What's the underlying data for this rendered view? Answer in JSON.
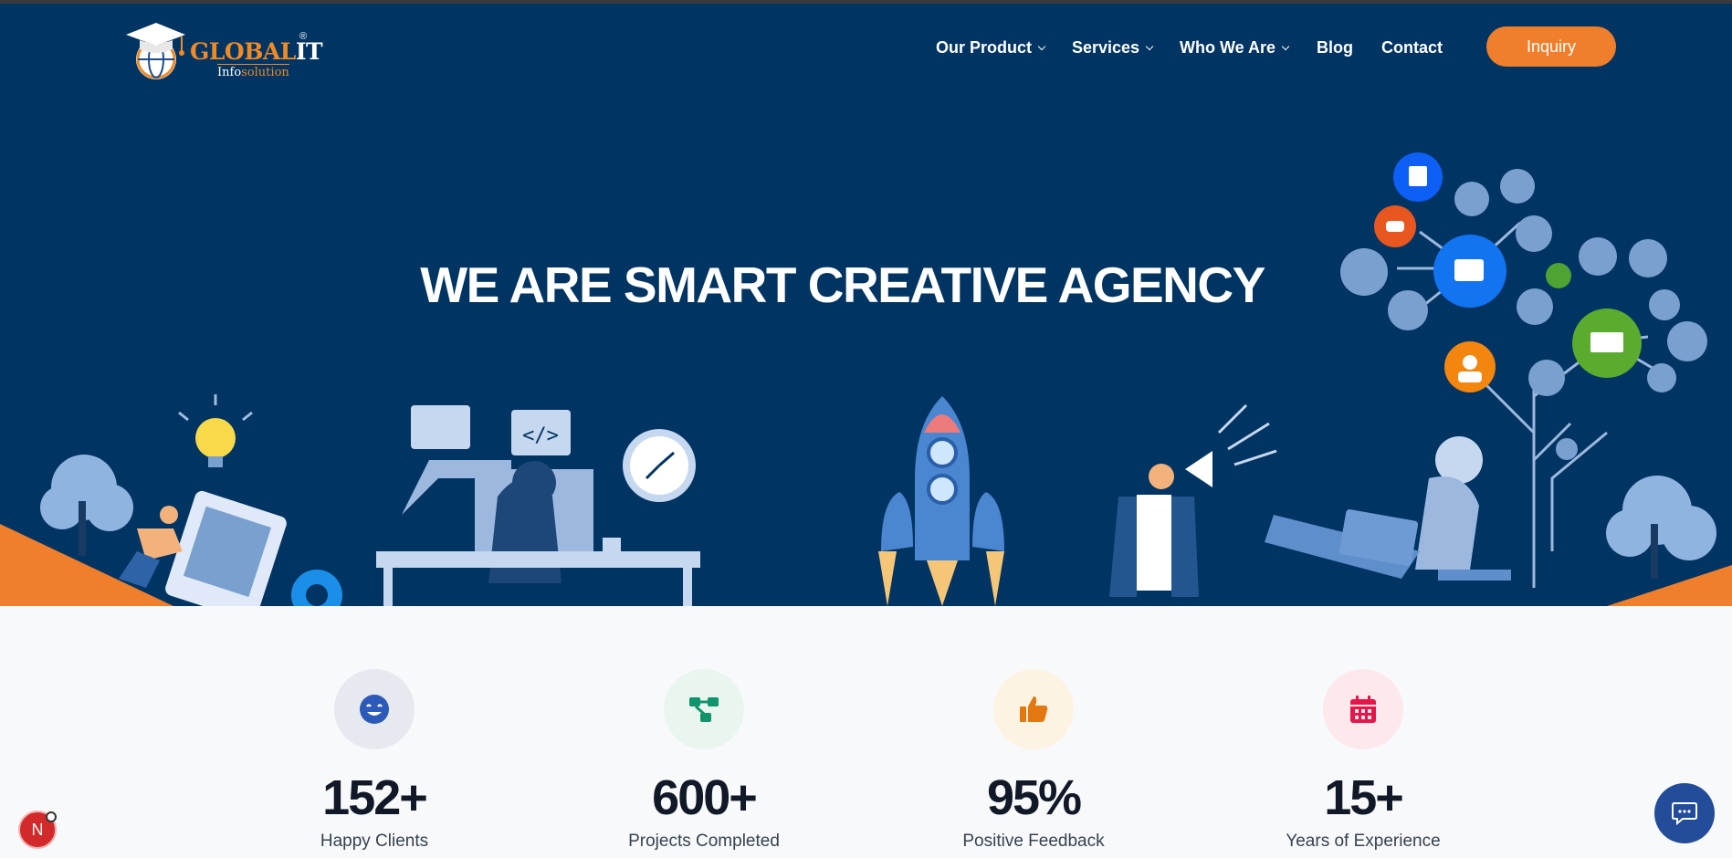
{
  "brand": {
    "logo_main": "GLOBAL",
    "logo_it": "IT",
    "logo_sub_a": "Info",
    "logo_sub_b": "solution",
    "registered": "®"
  },
  "nav": {
    "items": [
      {
        "label": "Our Product",
        "has_dropdown": true
      },
      {
        "label": "Services",
        "has_dropdown": true
      },
      {
        "label": "Who We Are",
        "has_dropdown": true
      },
      {
        "label": "Blog",
        "has_dropdown": false
      },
      {
        "label": "Contact",
        "has_dropdown": false
      }
    ],
    "cta_label": "Inquiry"
  },
  "hero": {
    "headline": "WE ARE SMART CREATIVE AGENCY"
  },
  "stats": [
    {
      "value": "152+",
      "label": "Happy Clients",
      "icon": "smile-icon",
      "color": "#2b5ab8",
      "bg": "#e6e9f0"
    },
    {
      "value": "600+",
      "label": "Projects Completed",
      "icon": "network-icon",
      "color": "#11946b",
      "bg": "#e8f6ef"
    },
    {
      "value": "95%",
      "label": "Positive Feedback",
      "icon": "thumbs-up-icon",
      "color": "#e2780f",
      "bg": "#fdf3e2"
    },
    {
      "value": "15+",
      "label": "Years of Experience",
      "icon": "calendar-icon",
      "color": "#e5164a",
      "bg": "#fde8ec"
    }
  ],
  "widgets": {
    "badge_letter": "N"
  },
  "colors": {
    "hero_bg": "#003462",
    "accent": "#f07f2c",
    "page_bg": "#f8f9fb"
  }
}
